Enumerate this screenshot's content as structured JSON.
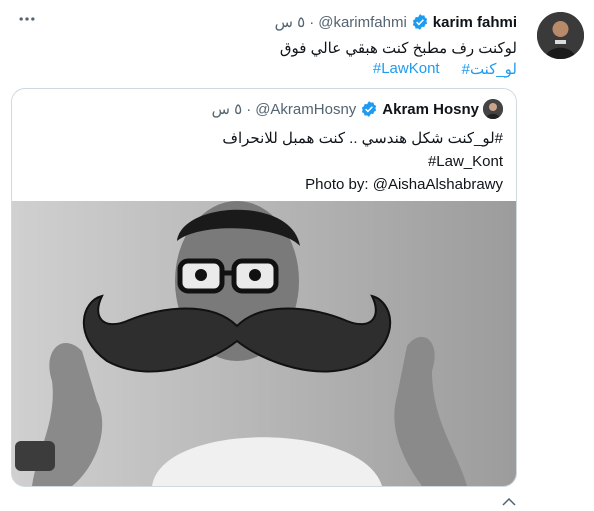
{
  "tweet": {
    "name": "karim fahmi",
    "handle": "@karimfahmi",
    "separator": "·",
    "time": "٥ س",
    "text": "لوكنت رف مطبخ كنت هبقي عالي فوق",
    "hashtags": [
      "#لو_كنت",
      "#LawKont"
    ]
  },
  "quoted": {
    "name": "Akram Hosny",
    "handle": "@AkramHosny",
    "separator": "·",
    "time": "٥ س",
    "line1": "#لو_كنت شكل هندسي .. كنت همبل للانحراف",
    "line2": "#Law_Kont",
    "line3": "Photo by: @AishaAlshabrawy"
  },
  "colors": {
    "accent": "#1d9bf0",
    "secondary_text": "#536471",
    "border": "#cfd9de"
  },
  "icons": {
    "more": "more-horizontal-icon",
    "verified": "verified-badge-icon"
  }
}
